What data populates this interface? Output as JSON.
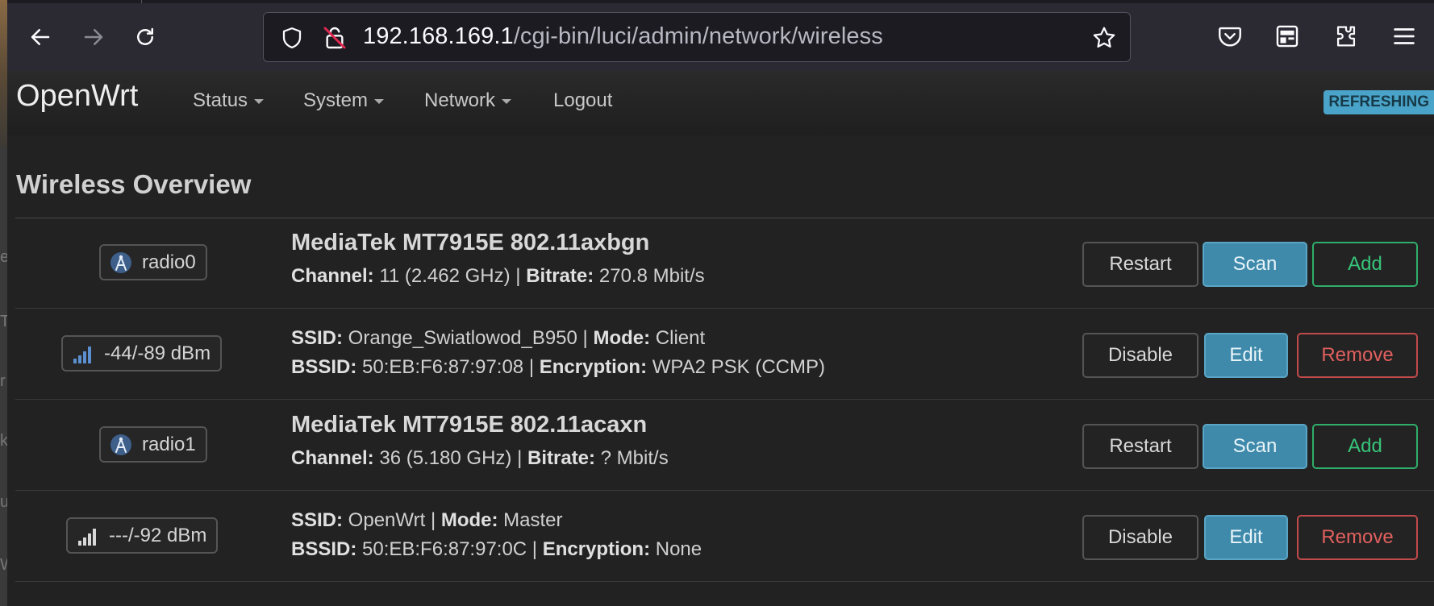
{
  "browser": {
    "url_host": "192.168.169.1",
    "url_path": "/cgi-bin/luci/admin/network/wireless",
    "left_glyphs": [
      "e",
      "T",
      "r",
      "k",
      "u",
      "W"
    ]
  },
  "header": {
    "brand": "OpenWrt",
    "menu": [
      "Status",
      "System",
      "Network",
      "Logout"
    ],
    "badge": "REFRESHING"
  },
  "page": {
    "title": "Wireless Overview",
    "rows": [
      {
        "tag": "radio0",
        "tag_icon": "wifi-antenna-icon",
        "title": "MediaTek MT7915E 802.11axbgn",
        "line2": [
          [
            "Channel:",
            " 11 (2.462 GHz) | "
          ],
          [
            "Bitrate:",
            " 270.8 Mbit/s"
          ]
        ],
        "buttons": [
          "Restart",
          "Scan",
          "Add"
        ]
      },
      {
        "tag": "-44/-89 dBm",
        "tag_icon": "signal-strength-icon",
        "line1": [
          [
            "SSID:",
            " Orange_Swiatlowod_B950 | "
          ],
          [
            "Mode:",
            " Client"
          ]
        ],
        "line2": [
          [
            "BSSID:",
            " 50:EB:F6:87:97:08 | "
          ],
          [
            "Encryption:",
            " WPA2 PSK (CCMP)"
          ]
        ],
        "buttons": [
          "Disable",
          "Edit",
          "Remove"
        ]
      },
      {
        "tag": "radio1",
        "tag_icon": "wifi-antenna-icon",
        "title": "MediaTek MT7915E 802.11acaxn",
        "line2": [
          [
            "Channel:",
            " 36 (5.180 GHz) | "
          ],
          [
            "Bitrate:",
            " ? Mbit/s"
          ]
        ],
        "buttons": [
          "Restart",
          "Scan",
          "Add"
        ]
      },
      {
        "tag": "---/-92 dBm",
        "tag_icon": "signal-strength-icon",
        "line1": [
          [
            "SSID:",
            " OpenWrt | "
          ],
          [
            "Mode:",
            " Master"
          ]
        ],
        "line2": [
          [
            "BSSID:",
            " 50:EB:F6:87:97:0C | "
          ],
          [
            "Encryption:",
            " None"
          ]
        ],
        "buttons": [
          "Disable",
          "Edit",
          "Remove"
        ]
      }
    ]
  },
  "colors": {
    "accent_blue": "#3f8aab",
    "add_green": "#37c47a",
    "remove_red": "#e0605e",
    "badge": "#4aa3c8",
    "signal_on": "#5b8fd0"
  }
}
